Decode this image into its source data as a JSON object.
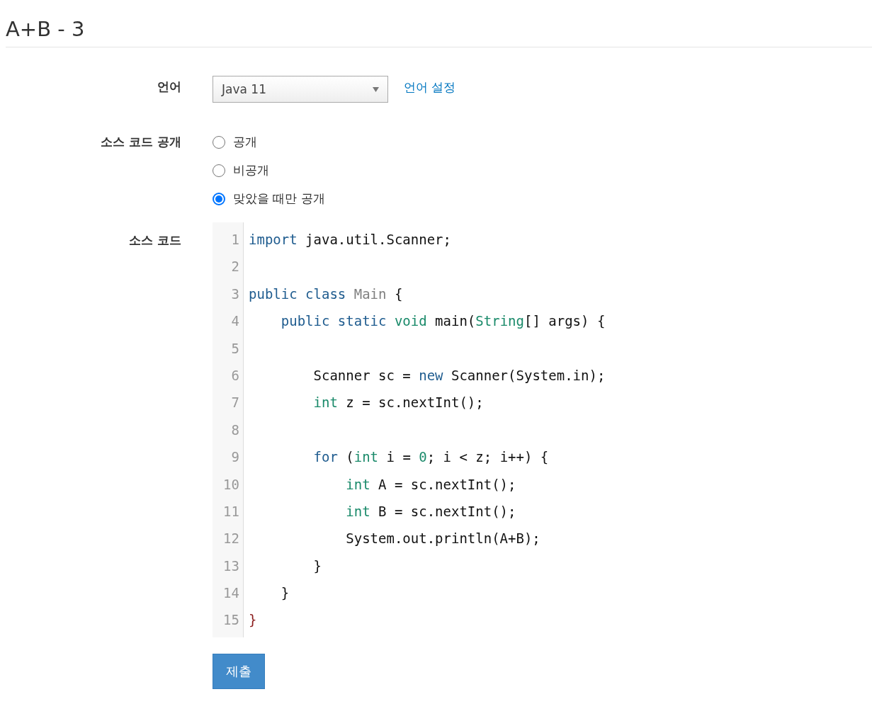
{
  "title": "A+B - 3",
  "language": {
    "label": "언어",
    "value": "Java 11",
    "link": "언어 설정"
  },
  "visibility": {
    "label": "소스 코드 공개",
    "options": [
      {
        "label": "공개",
        "selected": false
      },
      {
        "label": "비공개",
        "selected": false
      },
      {
        "label": "맞았을 때만 공개",
        "selected": true
      }
    ]
  },
  "source": {
    "label": "소스 코드",
    "lines": [
      {
        "number": "1",
        "tokens": [
          {
            "text": "import",
            "kind": "keyword"
          },
          {
            "text": " java.util.Scanner;",
            "kind": "plain"
          }
        ]
      },
      {
        "number": "2"
      },
      {
        "number": "3",
        "tokens": [
          {
            "text": "public class ",
            "kind": "keyword"
          },
          {
            "text": "Main",
            "kind": "def"
          },
          {
            "text": " {",
            "kind": "plain"
          }
        ]
      },
      {
        "number": "4",
        "tokens": [
          {
            "text": "    public static ",
            "kind": "keyword"
          },
          {
            "text": "void",
            "kind": "type"
          },
          {
            "text": " main(",
            "kind": "plain"
          },
          {
            "text": "String",
            "kind": "type"
          },
          {
            "text": "[] args) {",
            "kind": "plain"
          }
        ]
      },
      {
        "number": "5"
      },
      {
        "number": "6",
        "tokens": [
          {
            "text": "        Scanner sc = ",
            "kind": "plain"
          },
          {
            "text": "new",
            "kind": "keyword"
          },
          {
            "text": " Scanner(System.in);",
            "kind": "plain"
          }
        ]
      },
      {
        "number": "7",
        "tokens": [
          {
            "text": "        int",
            "kind": "type"
          },
          {
            "text": " z = sc.nextInt();",
            "kind": "plain"
          }
        ]
      },
      {
        "number": "8"
      },
      {
        "number": "9",
        "tokens": [
          {
            "text": "        for",
            "kind": "keyword"
          },
          {
            "text": " (",
            "kind": "plain"
          },
          {
            "text": "int",
            "kind": "type"
          },
          {
            "text": " i = ",
            "kind": "plain"
          },
          {
            "text": "0",
            "kind": "number"
          },
          {
            "text": "; i < z; i++) {",
            "kind": "plain"
          }
        ]
      },
      {
        "number": "10",
        "tokens": [
          {
            "text": "            int",
            "kind": "type"
          },
          {
            "text": " A = sc.nextInt();",
            "kind": "plain"
          }
        ]
      },
      {
        "number": "11",
        "tokens": [
          {
            "text": "            int",
            "kind": "type"
          },
          {
            "text": " B = sc.nextInt();",
            "kind": "plain"
          }
        ]
      },
      {
        "number": "12",
        "tokens": [
          {
            "text": "            System.out.println(A+B);",
            "kind": "plain"
          }
        ]
      },
      {
        "number": "13",
        "tokens": [
          {
            "text": "        }",
            "kind": "plain"
          }
        ]
      },
      {
        "number": "14",
        "tokens": [
          {
            "text": "    }",
            "kind": "plain"
          }
        ]
      },
      {
        "number": "15",
        "tokens": [
          {
            "text": "}",
            "kind": "bracket"
          }
        ]
      }
    ]
  },
  "submit": "제출"
}
